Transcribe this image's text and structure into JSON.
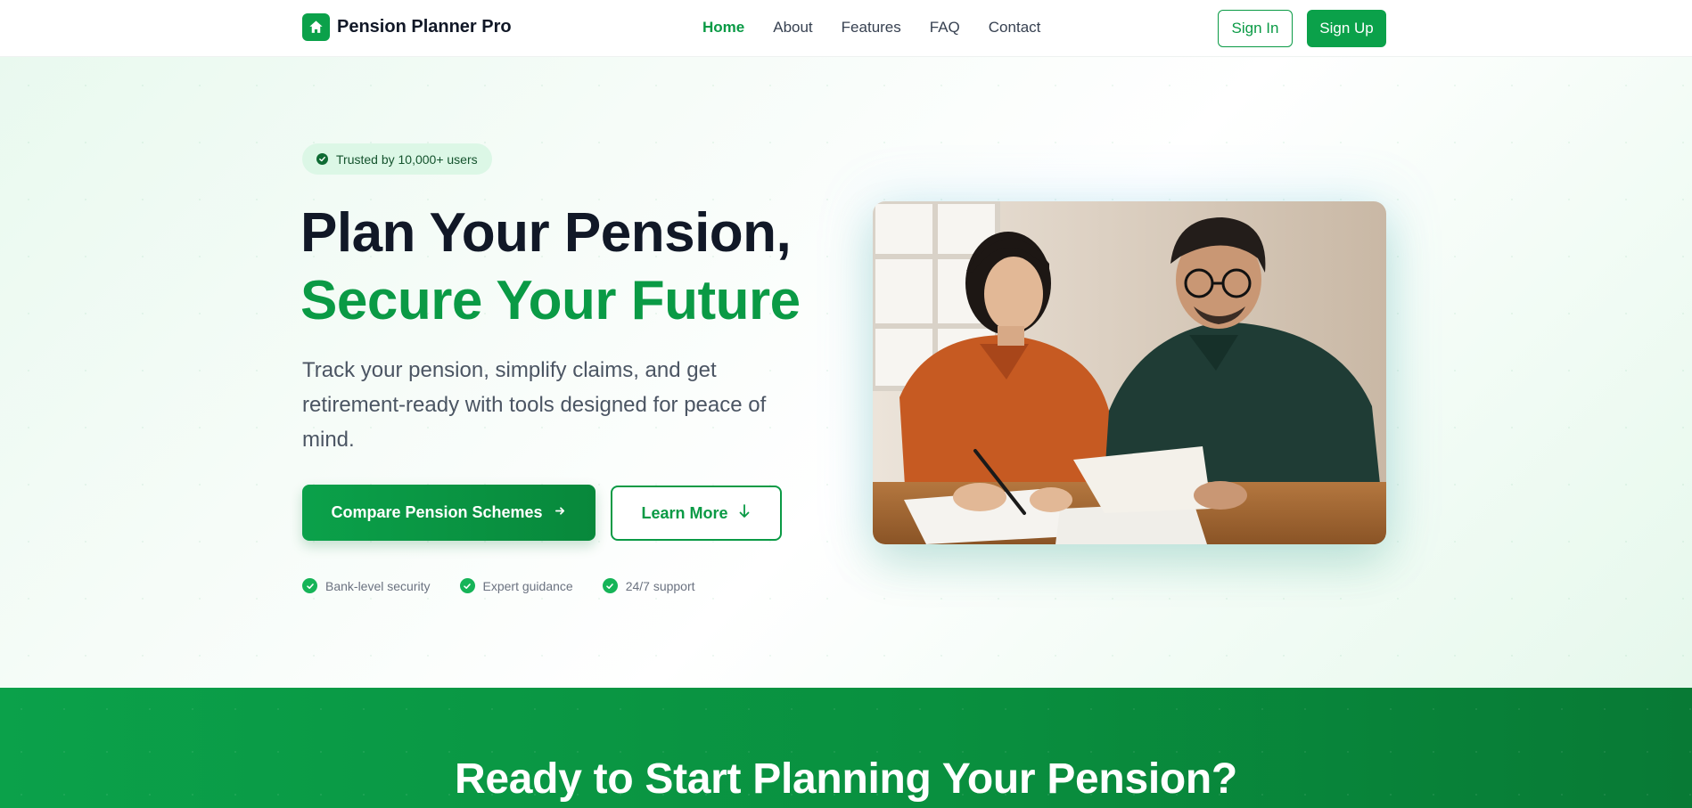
{
  "brand": {
    "name": "Pension Planner Pro"
  },
  "nav": {
    "items": [
      {
        "label": "Home",
        "active": true
      },
      {
        "label": "About",
        "active": false
      },
      {
        "label": "Features",
        "active": false
      },
      {
        "label": "FAQ",
        "active": false
      },
      {
        "label": "Contact",
        "active": false
      }
    ],
    "signin_label": "Sign In",
    "signup_label": "Sign Up"
  },
  "hero": {
    "badge": "Trusted by 10,000+ users",
    "title_line1": "Plan Your Pension,",
    "title_line2": "Secure Your Future",
    "lead": "Track your pension, simplify claims, and get retirement-ready with tools designed for peace of mind.",
    "primary_cta": "Compare Pension Schemes",
    "secondary_cta": "Learn More",
    "features": [
      "Bank-level security",
      "Expert guidance",
      "24/7 support"
    ]
  },
  "cta": {
    "title": "Ready to Start Planning Your Pension?"
  },
  "colors": {
    "accent": "#0a9a45",
    "accent_bright": "#0ba14a",
    "text_dark": "#111827",
    "text_muted": "#4b5563"
  },
  "icons": {
    "brand_logo": "home-icon",
    "badge": "check-circle-icon",
    "primary_cta": "arrow-right-icon",
    "secondary_cta": "arrow-down-icon",
    "feature": "check-circle-icon"
  }
}
